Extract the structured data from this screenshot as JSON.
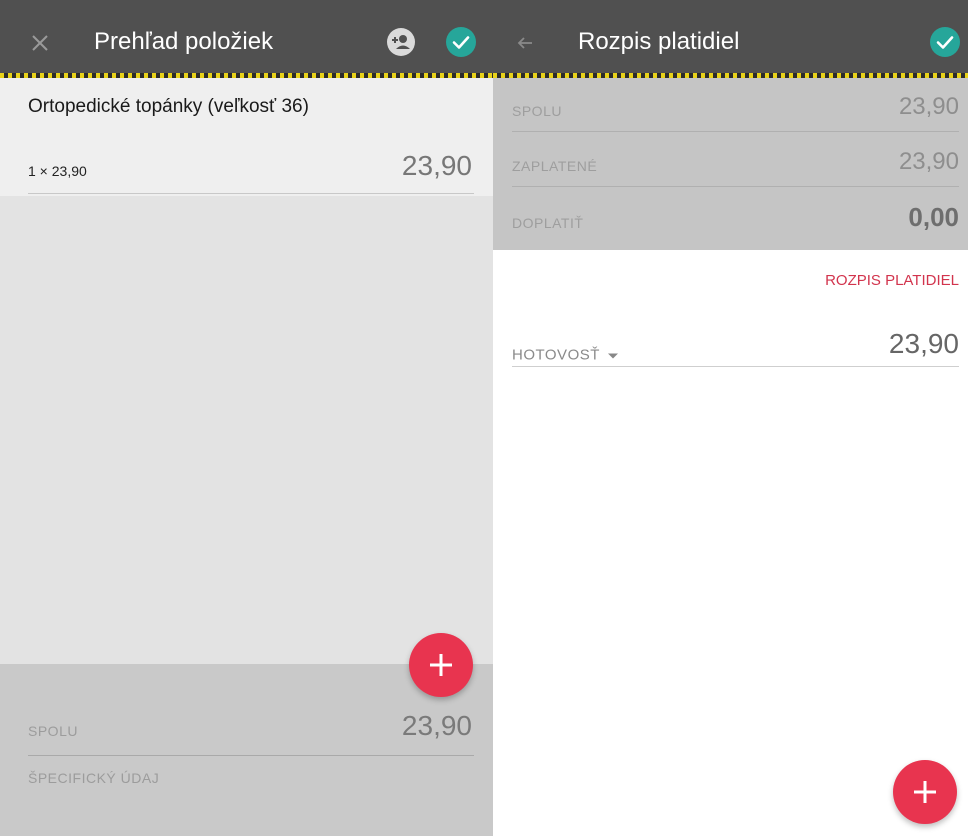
{
  "left_screen": {
    "appbar": {
      "close_icon": "close-icon",
      "title": "Prehľad položiek",
      "customer_icon": "add-customer-icon",
      "confirm_icon": "check-icon"
    },
    "item": {
      "name": "Ortopedické topánky (veľkosť 36)",
      "quantity_line": "1 × 23,90",
      "price": "23,90"
    },
    "totals": {
      "total_label": "SPOLU",
      "total_value": "23,90",
      "specific_label": "ŠPECIFICKÝ ÚDAJ"
    },
    "fab_icon": "plus-icon"
  },
  "right_screen": {
    "appbar": {
      "back_icon": "arrow-back-icon",
      "title": "Rozpis platidiel",
      "confirm_icon": "check-icon"
    },
    "summary": {
      "total_label": "SPOLU",
      "total_value": "23,90",
      "paid_label": "ZAPLATENÉ",
      "paid_value": "23,90",
      "due_label": "DOPLATIŤ",
      "due_value": "0,00"
    },
    "section_title": "ROZPIS PLATIDIEL",
    "payment": {
      "type": "HOTOVOSŤ",
      "amount": "23,90"
    },
    "fab_icon": "plus-icon"
  },
  "colors": {
    "appbar": "#505050",
    "accent_red": "#e8344f",
    "confirm_teal": "#26a69a",
    "stripe_yellow": "#e8d21a"
  }
}
